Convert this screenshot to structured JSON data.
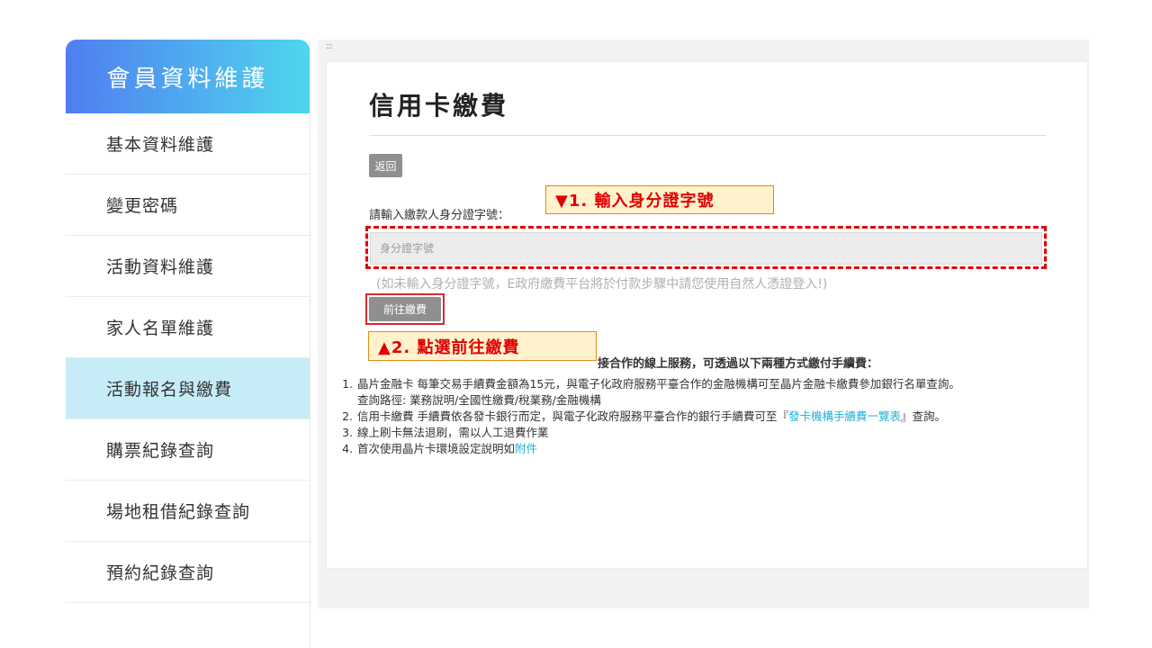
{
  "sidebar": {
    "title": "會員資料維護",
    "items": [
      {
        "label": "基本資料維護"
      },
      {
        "label": "變更密碼"
      },
      {
        "label": "活動資料維護"
      },
      {
        "label": "家人名單維護"
      },
      {
        "label": "活動報名與繳費",
        "active": true
      },
      {
        "label": "購票紀錄查詢"
      },
      {
        "label": "場地租借紀錄查詢"
      },
      {
        "label": "預約紀錄查詢"
      }
    ]
  },
  "main": {
    "dots": ":::",
    "title": "信用卡繳費",
    "back_label": "返回",
    "id_label": "請輸入繳款人身分證字號：",
    "id_placeholder": "身分證字號",
    "hint": "(如未輸入身分證字號，E政府繳費平台將於付款步驟中請您使用自然人憑證登入!)",
    "go_label": "前往繳費",
    "callout_1": "▼1. 輸入身分證字號",
    "callout_2": "▲2. 點選前往繳費",
    "info_head": "接合作的線上服務，可透過以下兩種方式繳付手續費：",
    "info": [
      {
        "num": "1.",
        "lines": [
          "晶片金融卡 每筆交易手續費金額為15元，與電子化政府服務平臺合作的金融機構可至晶片金融卡繳費參加銀行名單查詢。"
        ],
        "sub": "查詢路徑: 業務說明/全國性繳費/稅業務/金融機構"
      },
      {
        "num": "2.",
        "pre": "信用卡繳費 手續費依各發卡銀行而定，與電子化政府服務平臺合作的銀行手續費可至『",
        "link": "發卡機構手續費一覽表",
        "post": "』查詢。"
      },
      {
        "num": "3.",
        "text": "線上刷卡無法退刷，需以人工退費作業"
      },
      {
        "num": "4.",
        "pre": "首次使用晶片卡環境設定說明如",
        "link": "附件"
      }
    ]
  },
  "colors": {
    "accent_link": "#23b0d5",
    "callout_text": "#e00000",
    "callout_bg": "#fff2cc",
    "active_item_bg": "#c6ecf8"
  }
}
